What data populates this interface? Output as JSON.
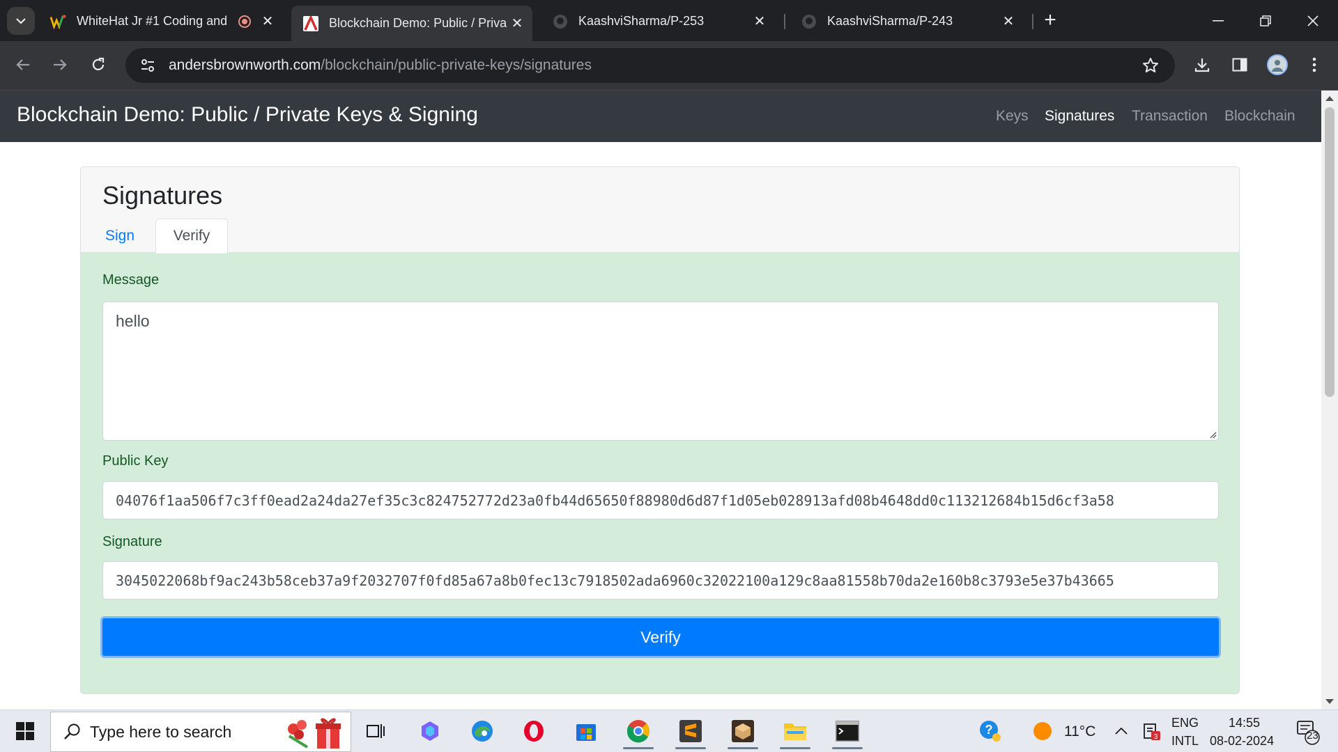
{
  "browser": {
    "tabs": [
      {
        "title": "WhiteHat Jr #1 Coding and",
        "active": false
      },
      {
        "title": "Blockchain Demo: Public / Priva",
        "active": true
      },
      {
        "title": "KaashviSharma/P-253",
        "active": false
      },
      {
        "title": "KaashviSharma/P-243",
        "active": false
      }
    ],
    "address": {
      "host": "andersbrownworth.com",
      "path": "/blockchain/public-private-keys/signatures"
    }
  },
  "site": {
    "brand": "Blockchain Demo: Public / Private Keys & Signing",
    "nav": [
      "Keys",
      "Signatures",
      "Transaction",
      "Blockchain"
    ],
    "active_nav": "Signatures"
  },
  "card": {
    "title": "Signatures",
    "tabs": [
      "Sign",
      "Verify"
    ],
    "active_tab": "Verify",
    "message": {
      "label": "Message",
      "value": "hello"
    },
    "public_key": {
      "label": "Public Key",
      "value": "04076f1aa506f7c3ff0ead2a24da27ef35c3c824752772d23a0fb44d65650f88980d6d87f1d05eb028913afd08b4648dd0c113212684b15d6cf3a58"
    },
    "signature": {
      "label": "Signature",
      "value": "3045022068bf9ac243b58ceb37a9f2032707f0fd85a67a8b0fec13c7918502ada6960c32022100a129c8aa81558b70da2e160b8c3793e5e37b43665"
    },
    "button": "Verify"
  },
  "taskbar": {
    "search_placeholder": "Type here to search",
    "weather": "11°C",
    "lang_top": "ENG",
    "lang_bottom": "INTL",
    "time": "14:55",
    "date": "08-02-2024",
    "notif_count": "23"
  },
  "colors": {
    "navbar": "#343a40",
    "success_bg": "#d4edda",
    "primary": "#007bff",
    "label_green": "#155724"
  }
}
